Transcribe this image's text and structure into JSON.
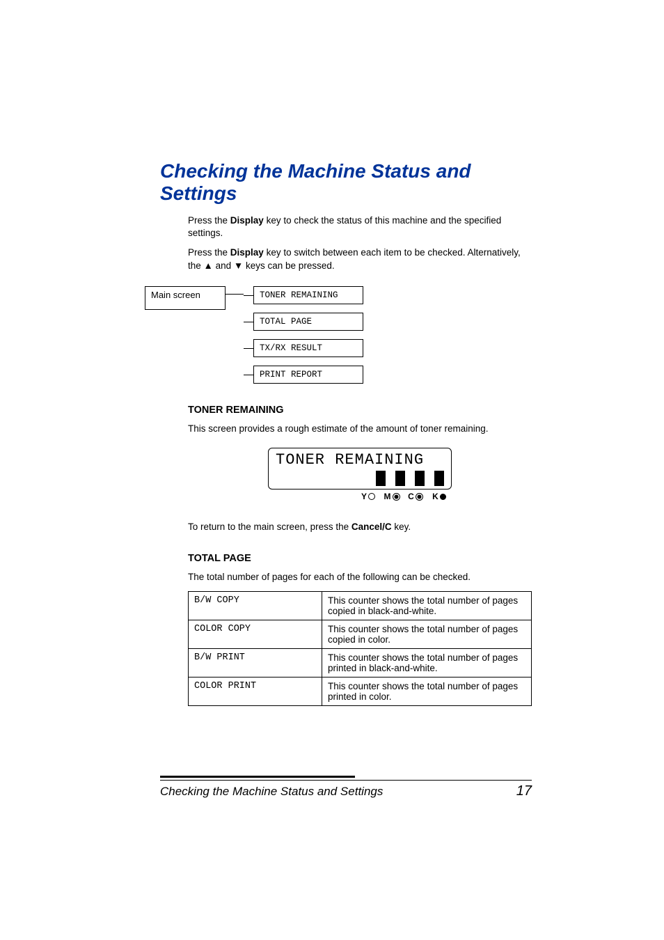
{
  "heading": "Checking the Machine Status and Settings",
  "intro": {
    "p1a": "Press the ",
    "p1b": "Display",
    "p1c": " key to check the status of this machine and the specified settings.",
    "p2a": "Press the ",
    "p2b": "Display",
    "p2c": " key to switch between each item to be checked. Alternatively, the ▲ and ▼ keys can be pressed."
  },
  "diagram": {
    "main": "Main screen",
    "items": [
      "TONER REMAINING",
      "TOTAL PAGE",
      "TX/RX RESULT",
      "PRINT REPORT"
    ]
  },
  "section_toner": {
    "title": "TONER REMAINING",
    "p1": "This screen provides a rough estimate of the amount of toner remaining.",
    "lcd_title": "TONER REMAINING",
    "labels": [
      "Y",
      "M",
      "C",
      "K"
    ],
    "p2a": "To return to the main screen, press the ",
    "p2b": "Cancel/C",
    "p2c": " key."
  },
  "section_total": {
    "title": "TOTAL PAGE",
    "p1": "The total number of pages for each of the following can be checked.",
    "rows": [
      {
        "label": "B/W COPY",
        "desc": "This counter shows the total number of pages copied in black-and-white."
      },
      {
        "label": "COLOR COPY",
        "desc": "This counter shows the total number of pages copied in color."
      },
      {
        "label": "B/W PRINT",
        "desc": "This counter shows the total number of pages printed in black-and-white."
      },
      {
        "label": "COLOR PRINT",
        "desc": "This counter shows the total number of pages printed in color."
      }
    ]
  },
  "footer": {
    "title": "Checking the Machine Status and Settings",
    "page": "17"
  }
}
